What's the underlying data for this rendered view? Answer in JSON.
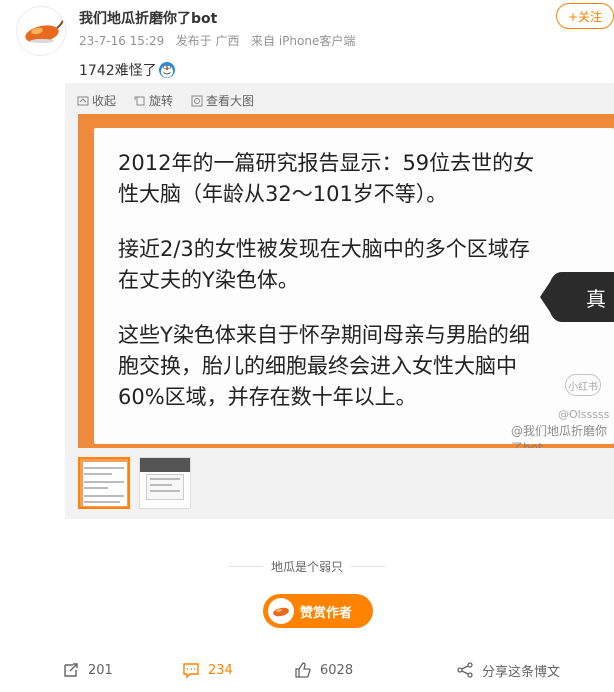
{
  "post": {
    "username": "我们地瓜折磨你了bot",
    "time": "23-7-16 15:29",
    "location": "发布于 广西",
    "source": "来自 iPhone客户端",
    "follow_label": "+关注",
    "text": "1742难怪了",
    "emoji": "doraemon-face-icon"
  },
  "media_toolbar": {
    "collapse": "收起",
    "rotate": "旋转",
    "view_large": "查看大图"
  },
  "image_content": {
    "para1_line1": "2012年的一篇研究报告显示：59位去世的女",
    "para1_line2": "性大脑（年龄从32～101岁不等）。",
    "para2_line1": "接近2/3的女性被发现在大脑中的多个区域存",
    "para2_line2": "在丈夫的Y染色体。",
    "para3_line1": "这些Y染色体来自于怀孕期间母亲与男胎的细",
    "para3_line2": "胞交换，胎儿的细胞最终会进入女性大脑中",
    "para3_line3": "60%区域，并存在数十年以上。",
    "side_tab": "真",
    "wm_circle": "小红书",
    "wm_small": "@Olsssss",
    "wm_main": "@我们地瓜折磨你了bot"
  },
  "thumbnails_count": 2,
  "divider": {
    "title": "地瓜是个弱只"
  },
  "reward": {
    "label": "赞赏作者"
  },
  "footer": {
    "repost": "201",
    "comment": "234",
    "like": "6028",
    "share": "分享这条博文"
  },
  "colors": {
    "accent": "#ff8200",
    "image_border": "#f08a3b",
    "meta_gray": "#939393"
  }
}
